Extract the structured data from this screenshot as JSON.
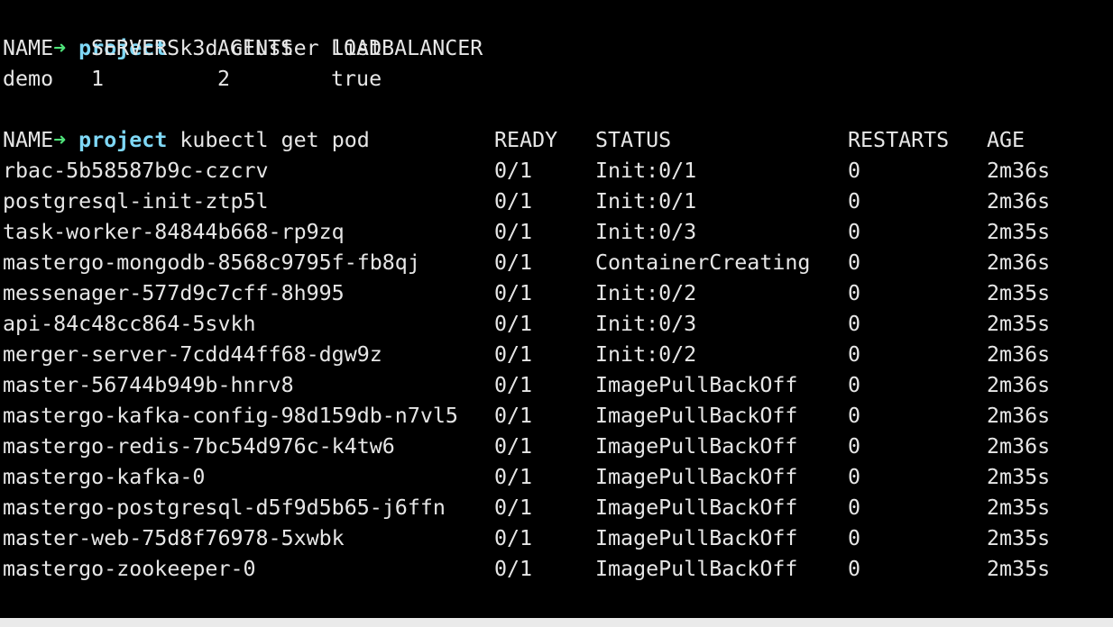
{
  "prompt": {
    "arrow": "➜",
    "dir": "project"
  },
  "commands": {
    "cluster_list": "k3d cluster list",
    "get_pod": "kubectl get pod"
  },
  "cluster_table": {
    "headers": [
      "NAME",
      "SERVERS",
      "AGENTS",
      "LOADBALANCER"
    ],
    "rows": [
      [
        "demo",
        "1",
        "2",
        "true"
      ]
    ]
  },
  "pod_table": {
    "headers": [
      "NAME",
      "READY",
      "STATUS",
      "RESTARTS",
      "AGE"
    ],
    "rows": [
      [
        "rbac-5b58587b9c-czcrv",
        "0/1",
        "Init:0/1",
        "0",
        "2m36s"
      ],
      [
        "postgresql-init-ztp5l",
        "0/1",
        "Init:0/1",
        "0",
        "2m36s"
      ],
      [
        "task-worker-84844b668-rp9zq",
        "0/1",
        "Init:0/3",
        "0",
        "2m35s"
      ],
      [
        "mastergo-mongodb-8568c9795f-fb8qj",
        "0/1",
        "ContainerCreating",
        "0",
        "2m36s"
      ],
      [
        "messenager-577d9c7cff-8h995",
        "0/1",
        "Init:0/2",
        "0",
        "2m35s"
      ],
      [
        "api-84c48cc864-5svkh",
        "0/1",
        "Init:0/3",
        "0",
        "2m35s"
      ],
      [
        "merger-server-7cdd44ff68-dgw9z",
        "0/1",
        "Init:0/2",
        "0",
        "2m36s"
      ],
      [
        "master-56744b949b-hnrv8",
        "0/1",
        "ImagePullBackOff",
        "0",
        "2m36s"
      ],
      [
        "mastergo-kafka-config-98d159db-n7vl5",
        "0/1",
        "ImagePullBackOff",
        "0",
        "2m36s"
      ],
      [
        "mastergo-redis-7bc54d976c-k4tw6",
        "0/1",
        "ImagePullBackOff",
        "0",
        "2m36s"
      ],
      [
        "mastergo-kafka-0",
        "0/1",
        "ImagePullBackOff",
        "0",
        "2m35s"
      ],
      [
        "mastergo-postgresql-d5f9d5b65-j6ffn",
        "0/1",
        "ImagePullBackOff",
        "0",
        "2m35s"
      ],
      [
        "master-web-75d8f76978-5xwbk",
        "0/1",
        "ImagePullBackOff",
        "0",
        "2m35s"
      ],
      [
        "mastergo-zookeeper-0",
        "0/1",
        "ImagePullBackOff",
        "0",
        "2m35s"
      ]
    ]
  },
  "colors": {
    "background": "#000000",
    "text": "#e6e6e6",
    "prompt_arrow": "#4fe37a",
    "prompt_dir": "#7fd8f6"
  }
}
